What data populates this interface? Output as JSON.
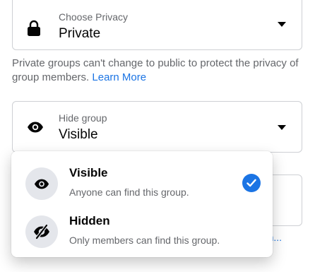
{
  "privacy": {
    "label": "Choose Privacy",
    "value": "Private",
    "icon": "lock-icon"
  },
  "description": {
    "text": "Private groups can't change to public to protect the privacy of group members.",
    "link": "Learn More"
  },
  "hide_group": {
    "label": "Hide group",
    "value": "Visible",
    "icon": "eye-icon"
  },
  "menu": {
    "items": [
      {
        "title": "Visible",
        "subtitle": "Anyone can find this group.",
        "icon": "eye-icon",
        "selected": true
      },
      {
        "title": "Hidden",
        "subtitle": "Only members can find this group.",
        "icon": "eye-slash-icon",
        "selected": false
      }
    ]
  },
  "background": {
    "truncated_link": "ann..."
  },
  "colors": {
    "accent": "#1b74e4",
    "text_primary": "#050505",
    "text_secondary": "#65676b",
    "border": "#ced0d4",
    "icon_bg": "#e4e6eb"
  }
}
